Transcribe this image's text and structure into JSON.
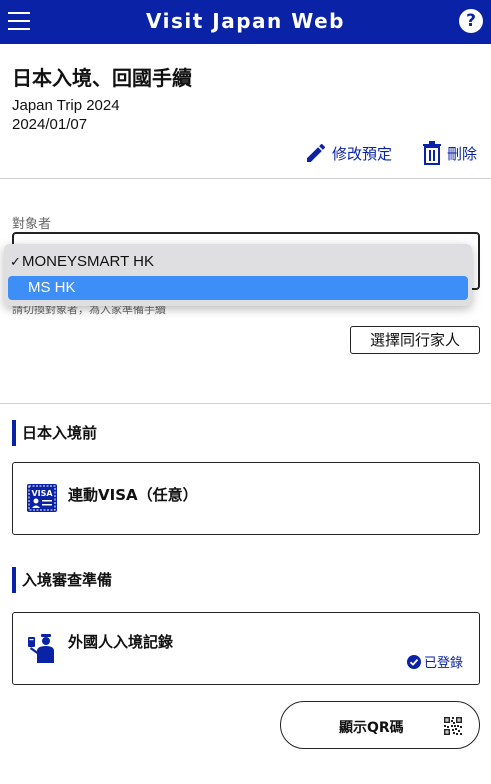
{
  "header": {
    "title": "Visit Japan Web",
    "menu_icon": "hamburger-menu-icon",
    "help_icon": "help-question-icon",
    "help_glyph": "?",
    "background": "#0a22a6"
  },
  "page": {
    "title": "日本入境、回國手續",
    "trip_name": "Japan Trip 2024",
    "trip_date": "2024/01/07"
  },
  "actions": {
    "edit_label": "修改預定",
    "edit_icon": "pencil-icon",
    "delete_label": "刪除",
    "delete_icon": "trash-icon"
  },
  "target": {
    "label": "對象者",
    "hint": "請切換對象者，為入家準備手續",
    "dropdown_options": [
      {
        "label": "MONEYSMART HK",
        "checked": true,
        "highlighted": false
      },
      {
        "label": "MS HK",
        "checked": false,
        "highlighted": true
      }
    ],
    "check_glyph": "✓",
    "companion_button": "選擇同行家人"
  },
  "sections": [
    {
      "heading": "日本入境前",
      "card": {
        "label": "連動VISA（任意）",
        "icon": "visa-icon"
      }
    },
    {
      "heading": "入境審查準備",
      "card": {
        "label": "外國人入境記錄",
        "icon": "immigration-officer-icon",
        "status": "已登錄",
        "status_icon": "check-circle-icon"
      }
    }
  ],
  "qr": {
    "label": "顯示QR碼",
    "icon": "qr-code-icon"
  },
  "colors": {
    "brand": "#0a22a6",
    "highlight": "#3e8ef7"
  }
}
